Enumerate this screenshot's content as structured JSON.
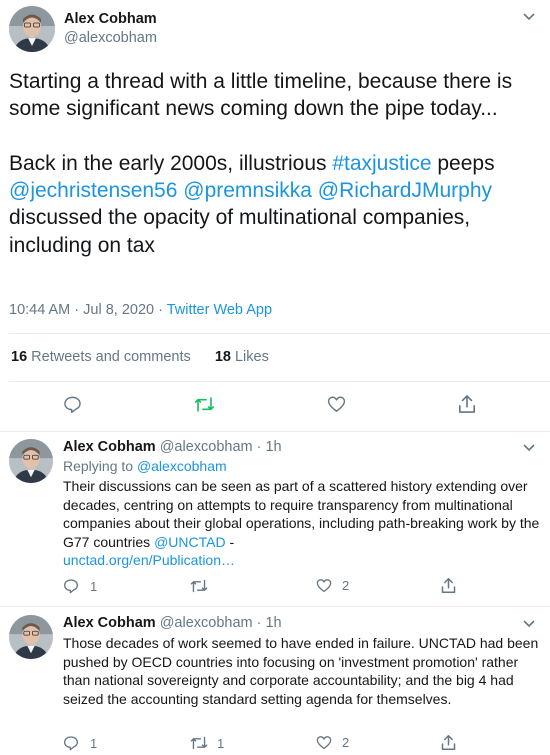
{
  "main": {
    "name": "Alex Cobham",
    "handle": "@alexcobham",
    "text_1": "Starting a thread with a little timeline, because there is some significant news coming down the pipe today...",
    "text_2": "Back in the early 2000s, illustrious ",
    "hashtag": "#taxjustice",
    "text_3": " peeps ",
    "mention_1": "@jechristensen56",
    "mention_2": "@premnsikka",
    "mention_3": "@RichardJMurphy",
    "text_4": "discussed the opacity of multinational companies, including on tax",
    "time": "10:44 AM · Jul 8, 2020 · ",
    "source": "Twitter Web App",
    "retweets_count": "16",
    "retweets_label": " Retweets and comments",
    "likes_count": "18",
    "likes_label": " Likes"
  },
  "replies": [
    {
      "name": "Alex Cobham",
      "handle": "@alexcobham · 1h",
      "replying_prefix": "Replying to ",
      "replying_to": "@alexcobham",
      "text": "Their discussions can be seen as part of a scattered history extending over decades, centring on attempts to require transparency from multinational companies about their global operations, including path-breaking work by the G77 countries ",
      "mention": "@UNCTAD",
      "text_tail": " -",
      "link": "unctad.org/en/Publication…",
      "reply_count": "1",
      "retweet_count": "",
      "like_count": "2"
    },
    {
      "name": "Alex Cobham",
      "handle": "@alexcobham · 1h",
      "text": "Those decades of work seemed to have ended in failure. UNCTAD had been pushed by OECD countries into focusing on 'investment promotion' rather than national sovereignty and corporate accountability; and the big 4 had seized the accounting standard setting agenda for themselves.",
      "reply_count": "1",
      "retweet_count": "1",
      "like_count": "2"
    }
  ],
  "icons": {
    "reply": "comment-icon",
    "retweet": "retweet-icon",
    "like": "heart-icon",
    "share": "share-icon",
    "more": "chevron-down-icon"
  },
  "colors": {
    "link": "#1b95e0",
    "retweet_active": "#17bf63",
    "secondary_text": "#657786",
    "divider": "#e6ecf0"
  }
}
